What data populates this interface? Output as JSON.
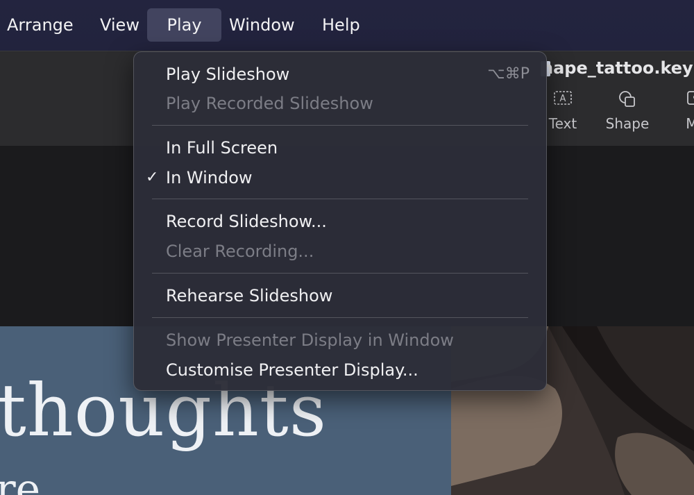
{
  "menubar": {
    "items": [
      "Arrange",
      "View",
      "Play",
      "Window",
      "Help"
    ],
    "active": "Play"
  },
  "document": {
    "title": "nape_tattoo.key"
  },
  "toolbar": {
    "tools": [
      {
        "label": "Text",
        "icon": "text-box-icon"
      },
      {
        "label": "Shape",
        "icon": "shape-icon"
      },
      {
        "label": "Me",
        "icon": "media-icon"
      }
    ]
  },
  "play_menu": {
    "items": [
      {
        "label": "Play Slideshow",
        "shortcut": "⌥⌘P",
        "enabled": true
      },
      {
        "label": "Play Recorded Slideshow",
        "enabled": false
      },
      {
        "label": "In Full Screen",
        "enabled": true
      },
      {
        "label": "In Window",
        "enabled": true,
        "checked": true
      },
      {
        "label": "Record Slideshow...",
        "enabled": true
      },
      {
        "label": "Clear Recording...",
        "enabled": false
      },
      {
        "label": "Rehearse Slideshow",
        "enabled": true
      },
      {
        "label": "Show Presenter Display in Window",
        "enabled": false
      },
      {
        "label": "Customise Presenter Display...",
        "enabled": true
      }
    ],
    "checkmark": "✓"
  },
  "slide": {
    "headline": "thoughts",
    "subline": "re"
  },
  "colors": {
    "menubar_bg": "#23243f",
    "menu_bg": "#2c2d38",
    "slide_bg": "#4a6078"
  }
}
